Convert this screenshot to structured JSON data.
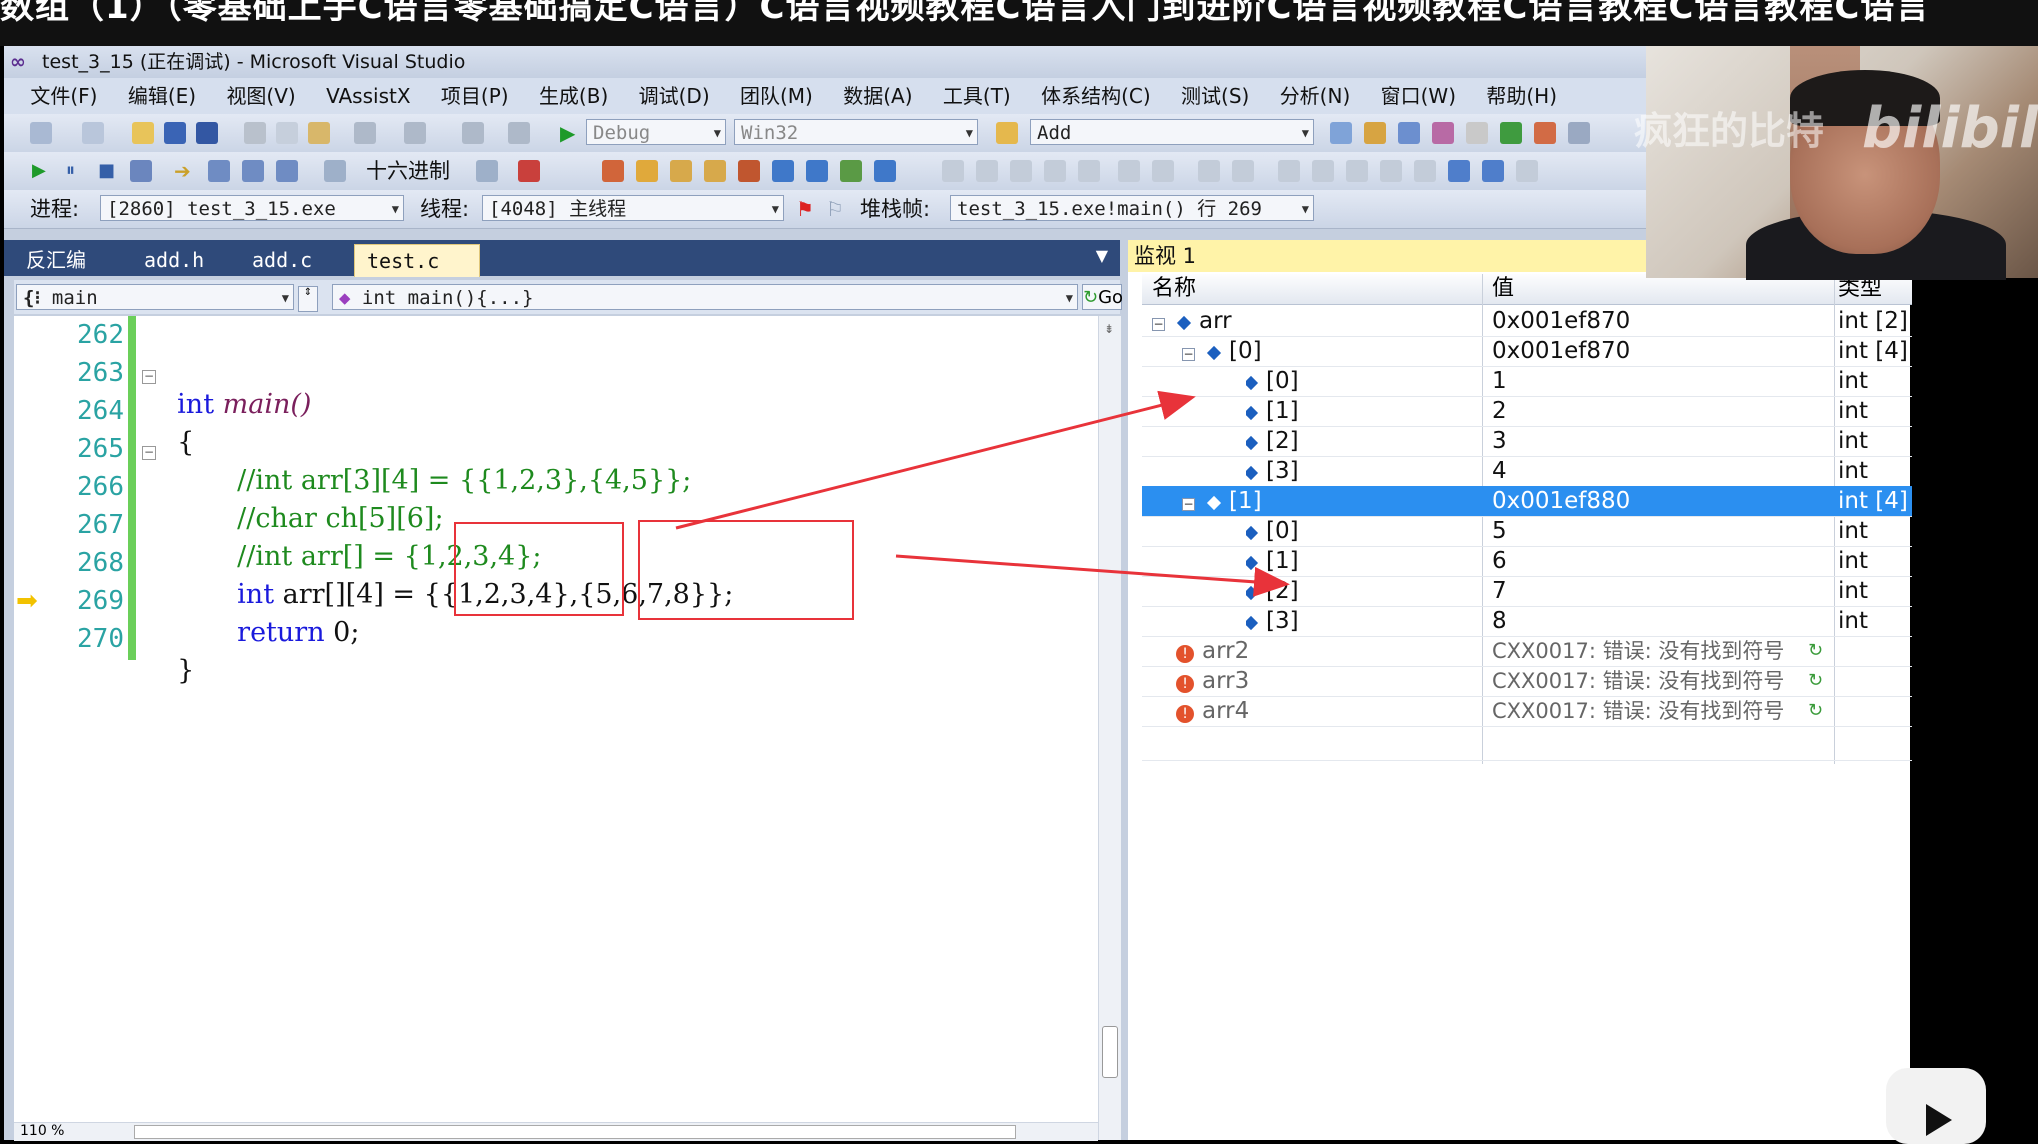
{
  "video": {
    "title_text": "数组（1）（零基础上手C语言零基础搞定C语言）C语言视频教程C语言入门到进阶C语言视频教程C语言教程C语言教程C语言"
  },
  "window": {
    "title": "test_3_15 (正在调试) - Microsoft Visual Studio"
  },
  "menu": [
    "文件(F)",
    "编辑(E)",
    "视图(V)",
    "VAssistX",
    "项目(P)",
    "生成(B)",
    "调试(D)",
    "团队(M)",
    "数据(A)",
    "工具(T)",
    "体系结构(C)",
    "测试(S)",
    "分析(N)",
    "窗口(W)",
    "帮助(H)"
  ],
  "toolbar1": {
    "config": "Debug",
    "platform": "Win32",
    "find": "Add"
  },
  "toolbar2": {
    "hex_label": "十六进制"
  },
  "debug_location": {
    "process_label": "进程:",
    "process": "[2860] test_3_15.exe",
    "thread_label": "线程:",
    "thread": "[4048] 主线程",
    "stack_label": "堆栈帧:",
    "stack": "test_3_15.exe!main()  行 269"
  },
  "tabs": [
    {
      "label": "反汇编"
    },
    {
      "label": "add.h"
    },
    {
      "label": "add.c"
    },
    {
      "label": "test.c"
    }
  ],
  "tab_close": "✕",
  "navbar": {
    "scope": "main",
    "member": "int main(){...}",
    "go": "Go"
  },
  "editor": {
    "line_numbers": [
      "262",
      "263",
      "264",
      "265",
      "266",
      "267",
      "268",
      "269",
      "270"
    ],
    "lines": [
      {
        "kw": "",
        "text": "",
        "comment": ""
      },
      {
        "kw": "int",
        "text": " main()",
        "comment": ""
      },
      {
        "kw": "",
        "text": "{",
        "comment": ""
      },
      {
        "kw": "",
        "text": "",
        "comment": "//int arr[3][4] = {{1,2,3},{4,5}};"
      },
      {
        "kw": "",
        "text": "",
        "comment": "//char ch[5][6];"
      },
      {
        "kw": "",
        "text": "",
        "comment": "//int arr[] = {1,2,3,4};"
      },
      {
        "kw": "int",
        "text": " arr[][4] = {{1,2,3,4},{5,6,7,8}};",
        "comment": ""
      },
      {
        "kw": "return",
        "text": " 0;",
        "comment": ""
      },
      {
        "kw": "",
        "text": "}",
        "comment": ""
      }
    ],
    "zoom": "110 %"
  },
  "watch": {
    "title": "监视 1",
    "headers": {
      "name": "名称",
      "value": "值",
      "type": "类型"
    },
    "rows": [
      {
        "name": "arr",
        "value": "0x001ef870",
        "type": "int [2]"
      },
      {
        "name": "[0]",
        "value": "0x001ef870",
        "type": "int [4]"
      },
      {
        "name": "[0]",
        "value": "1",
        "type": "int"
      },
      {
        "name": "[1]",
        "value": "2",
        "type": "int"
      },
      {
        "name": "[2]",
        "value": "3",
        "type": "int"
      },
      {
        "name": "[3]",
        "value": "4",
        "type": "int"
      },
      {
        "name": "[1]",
        "value": "0x001ef880",
        "type": "int [4]"
      },
      {
        "name": "[0]",
        "value": "5",
        "type": "int"
      },
      {
        "name": "[1]",
        "value": "6",
        "type": "int"
      },
      {
        "name": "[2]",
        "value": "7",
        "type": "int"
      },
      {
        "name": "[3]",
        "value": "8",
        "type": "int"
      },
      {
        "name": "arr2",
        "value": "CXX0017: 错误: 没有找到符号",
        "type": ""
      },
      {
        "name": "arr3",
        "value": "CXX0017: 错误: 没有找到符号",
        "type": ""
      },
      {
        "name": "arr4",
        "value": "CXX0017: 错误: 没有找到符号",
        "type": ""
      }
    ]
  },
  "webcam": {
    "watermark": "疯狂的比特",
    "logo": "bilibili"
  },
  "colors": {
    "annotation_red": "#e8333a",
    "selection_blue": "#2b8ff0",
    "keyword_blue": "#1a1adc",
    "comment_green": "#1e8a1e"
  }
}
